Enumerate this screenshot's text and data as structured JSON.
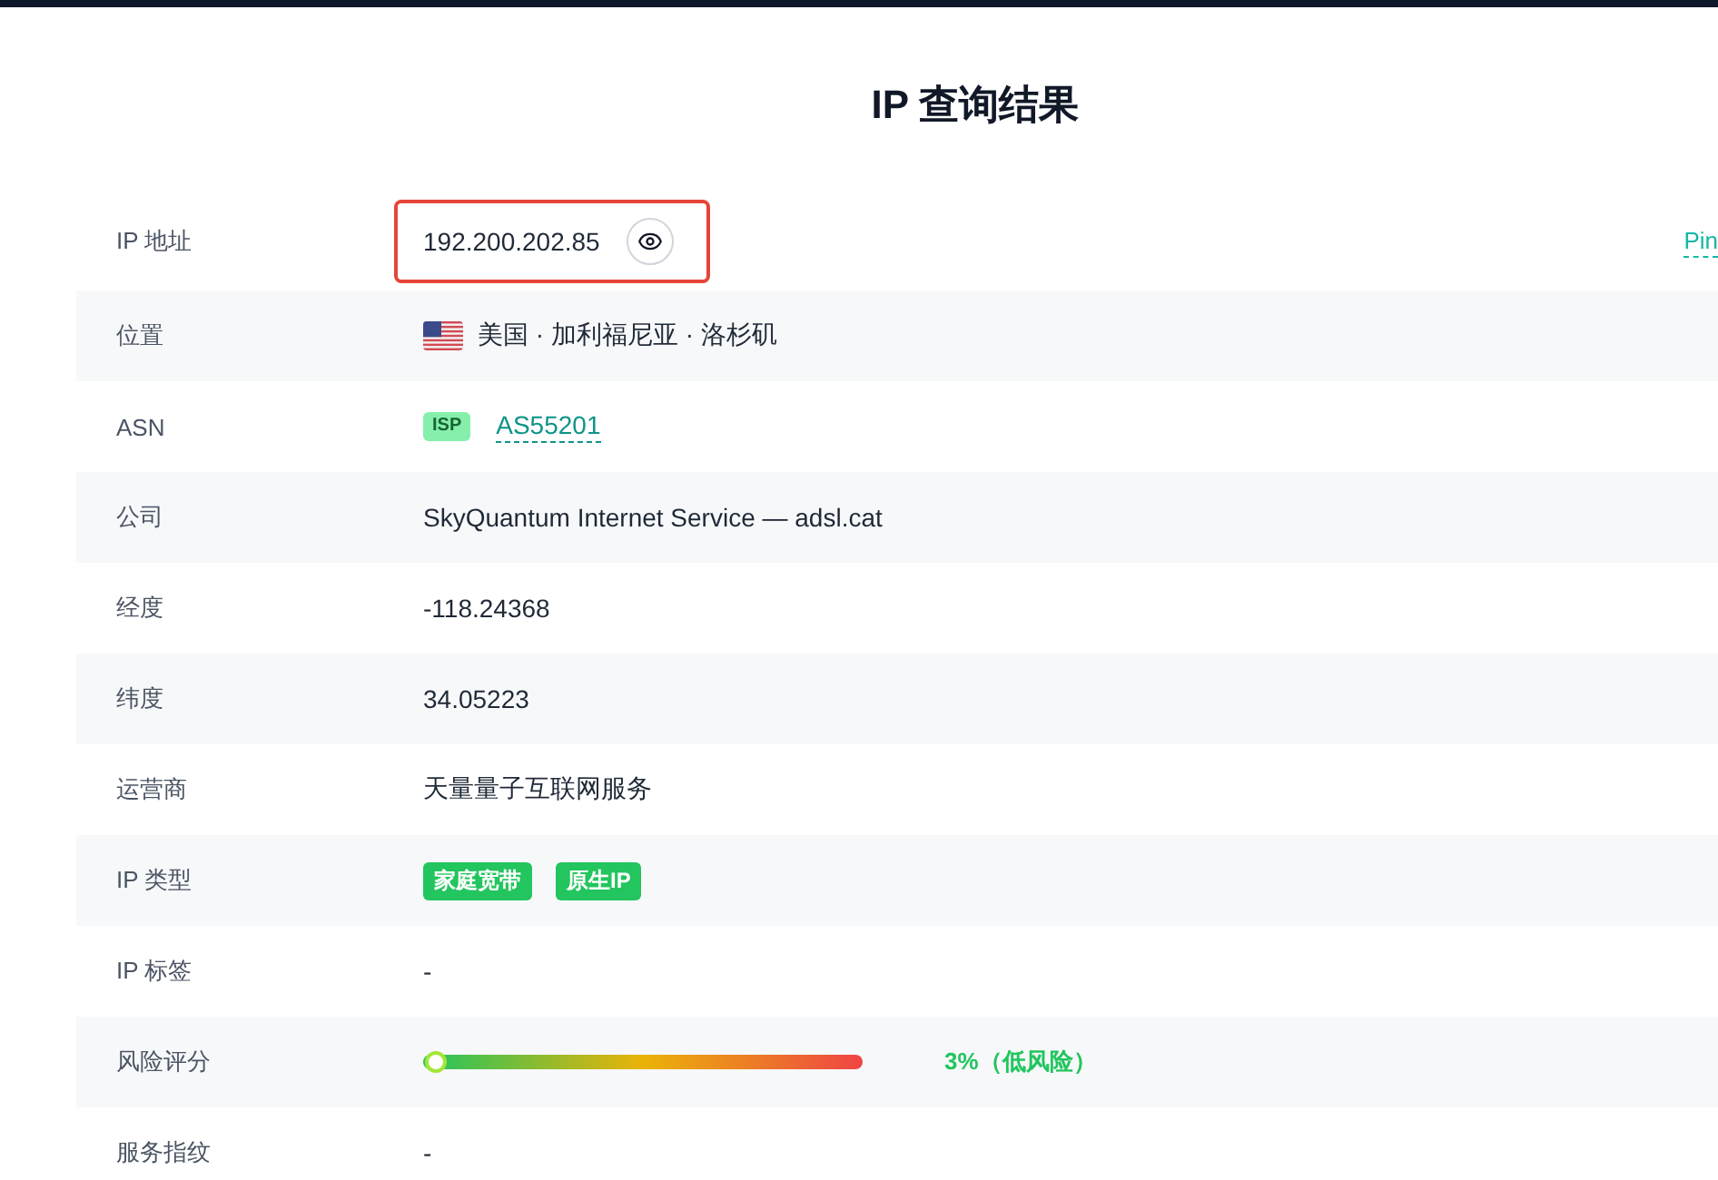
{
  "title": "IP 查询结果",
  "rows": [
    {
      "kind": "ip",
      "label": "IP 地址",
      "value": "192.200.202.85",
      "highlighted": true,
      "side_link": "Pin"
    },
    {
      "kind": "location",
      "label": "位置",
      "value": "美国 · 加利福尼亚 · 洛杉矶"
    },
    {
      "kind": "asn",
      "label": "ASN",
      "badge": "ISP",
      "link": "AS55201"
    },
    {
      "kind": "text",
      "label": "公司",
      "value": "SkyQuantum Internet Service — adsl.cat"
    },
    {
      "kind": "text",
      "label": "经度",
      "value": "-118.24368"
    },
    {
      "kind": "text",
      "label": "纬度",
      "value": "34.05223"
    },
    {
      "kind": "text",
      "label": "运营商",
      "value": "天量量子互联网服务"
    },
    {
      "kind": "tags",
      "label": "IP 类型",
      "tags": [
        "家庭宽带",
        "原生IP"
      ]
    },
    {
      "kind": "text",
      "label": "IP 标签",
      "value": "-"
    },
    {
      "kind": "risk",
      "label": "风险评分",
      "level": 0.03,
      "reading": "3%（低风险）"
    },
    {
      "kind": "text",
      "label": "服务指纹",
      "value": "-"
    }
  ]
}
